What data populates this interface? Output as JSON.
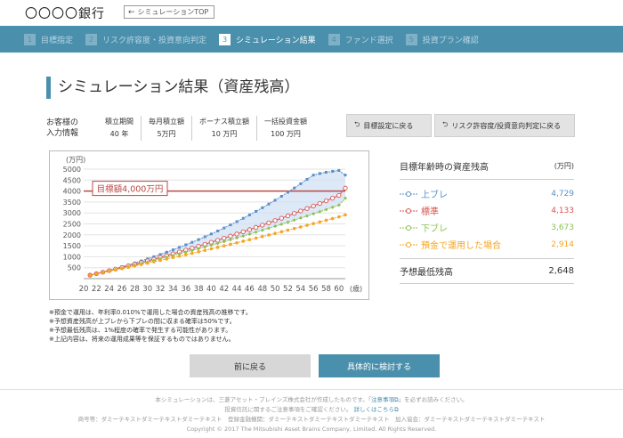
{
  "header": {
    "bank_name": "〇〇〇〇銀行",
    "top_link": "シミュレーションTOP"
  },
  "steps": [
    {
      "num": "1",
      "label": "目標指定",
      "active": false
    },
    {
      "num": "2",
      "label": "リスク許容度・投資意向判定",
      "active": false
    },
    {
      "num": "3",
      "label": "シミュレーション結果",
      "active": true
    },
    {
      "num": "4",
      "label": "ファンド選択",
      "active": false
    },
    {
      "num": "5",
      "label": "投資プラン確認",
      "active": false
    }
  ],
  "page_title": "シミュレーション結果（資産残高）",
  "info": {
    "label_line1": "お客様の",
    "label_line2": "入力情報",
    "cols": [
      {
        "head": "積立期間",
        "value": "40 年"
      },
      {
        "head": "毎月積立額",
        "value": "5万円"
      },
      {
        "head": "ボーナス積立額",
        "value": "10 万円"
      },
      {
        "head": "一括投資金額",
        "value": "100 万円"
      }
    ],
    "btn_goal": "目標設定に戻る",
    "btn_risk": "リスク許容度/投資意向判定に戻る"
  },
  "chart_data": {
    "type": "line",
    "unit_label": "(万円)",
    "x_suffix": "(歳)",
    "x": [
      21,
      22,
      23,
      24,
      25,
      26,
      27,
      28,
      29,
      30,
      31,
      32,
      33,
      34,
      35,
      36,
      37,
      38,
      39,
      40,
      41,
      42,
      43,
      44,
      45,
      46,
      47,
      48,
      49,
      50,
      51,
      52,
      53,
      54,
      55,
      56,
      57,
      58,
      59,
      60,
      61
    ],
    "x_ticks": [
      20,
      22,
      24,
      26,
      28,
      30,
      32,
      34,
      36,
      38,
      40,
      42,
      44,
      46,
      48,
      50,
      52,
      54,
      56,
      58,
      60
    ],
    "y_ticks": [
      500,
      1000,
      1500,
      2000,
      2500,
      3000,
      3500,
      4000,
      4500,
      5000
    ],
    "ylim": [
      0,
      5000
    ],
    "target": {
      "label": "目標額4,000万円",
      "value": 4000
    },
    "series": [
      {
        "name": "上ブレ",
        "color": "#5b8fc9",
        "marker": "square",
        "values": [
          160,
          232,
          306,
          383,
          462,
          544,
          630,
          718,
          809,
          904,
          1003,
          1104,
          1208,
          1316,
          1428,
          1543,
          1662,
          1784,
          1911,
          2041,
          2175,
          2314,
          2456,
          2603,
          2755,
          2911,
          3072,
          3237,
          3407,
          3582,
          3762,
          3947,
          4138,
          4333,
          4535,
          4729,
          4800,
          4860,
          4900,
          4940,
          4729
        ]
      },
      {
        "name": "標準",
        "color": "#d9534f",
        "marker": "circle",
        "values": [
          160,
          227,
          295,
          365,
          436,
          508,
          582,
          657,
          733,
          811,
          890,
          970,
          1052,
          1135,
          1219,
          1305,
          1392,
          1480,
          1570,
          1661,
          1754,
          1848,
          1943,
          2040,
          2138,
          2238,
          2339,
          2442,
          2546,
          2652,
          2759,
          2868,
          2978,
          3090,
          3203,
          3318,
          3435,
          3553,
          3673,
          3800,
          4133
        ]
      },
      {
        "name": "下ブレ",
        "color": "#8cc152",
        "marker": "diamond",
        "values": [
          160,
          223,
          287,
          352,
          418,
          485,
          553,
          622,
          692,
          763,
          835,
          908,
          982,
          1057,
          1133,
          1210,
          1288,
          1367,
          1447,
          1528,
          1610,
          1693,
          1777,
          1862,
          1948,
          2035,
          2123,
          2212,
          2302,
          2393,
          2485,
          2578,
          2672,
          2767,
          2863,
          2960,
          3058,
          3157,
          3257,
          3358,
          3673
        ]
      },
      {
        "name": "預金で運用した場合",
        "color": "#f5a623",
        "marker": "circle",
        "values": [
          160,
          219,
          278,
          338,
          398,
          459,
          520,
          582,
          644,
          707,
          770,
          834,
          898,
          963,
          1028,
          1094,
          1160,
          1227,
          1294,
          1362,
          1430,
          1499,
          1568,
          1638,
          1708,
          1779,
          1850,
          1922,
          1994,
          2067,
          2140,
          2214,
          2288,
          2363,
          2438,
          2514,
          2590,
          2667,
          2744,
          2822,
          2914
        ]
      }
    ]
  },
  "panel": {
    "title": "目標年齢時の資産残高",
    "unit": "(万円)",
    "rows": [
      {
        "name": "上ブレ",
        "value": "4,729",
        "color": "#5b8fc9"
      },
      {
        "name": "標準",
        "value": "4,133",
        "color": "#d9534f"
      },
      {
        "name": "下ブレ",
        "value": "3,673",
        "color": "#8cc152"
      },
      {
        "name": "預金で運用した場合",
        "value": "2,914",
        "color": "#f5a623"
      }
    ],
    "min_label": "予想最低残高",
    "min_value": "2,648"
  },
  "notes": [
    "※預金で運用は、年利率0.010%で運用した場合の資産残高の推移です。",
    "※予想資産残高が上ブレから下ブレの間に収まる確率は50%です。",
    "※予想最低残高は、1%程度の確率で発生する可能性があります。",
    "※上記内容は、将来の運用成果等を保証するものではありません。"
  ],
  "buttons": {
    "prev": "前に戻る",
    "next": "具体的に検討する"
  },
  "footer": {
    "line1_a": "本シミュレーションは、三菱アセット・ブレインズ株式会社が作成したものです。「",
    "line1_link": "注意事項",
    "line1_b": "」を必ずお読みください。",
    "line2_a": "投資信託に関するご注意事項をご確認ください。",
    "line2_link": "詳しくはこちら",
    "line3": "商号等：ダミーテキストダミーテキストダミーテキスト　登録金融機関：ダミーテキストダミーテキストダミーテキスト　加入協会：ダミーテキストダミーテキストダミーテキスト",
    "copyright": "Copyright © 2017 The Mitsubishi Asset Brains Company, Limited. All Rights Reserved."
  }
}
